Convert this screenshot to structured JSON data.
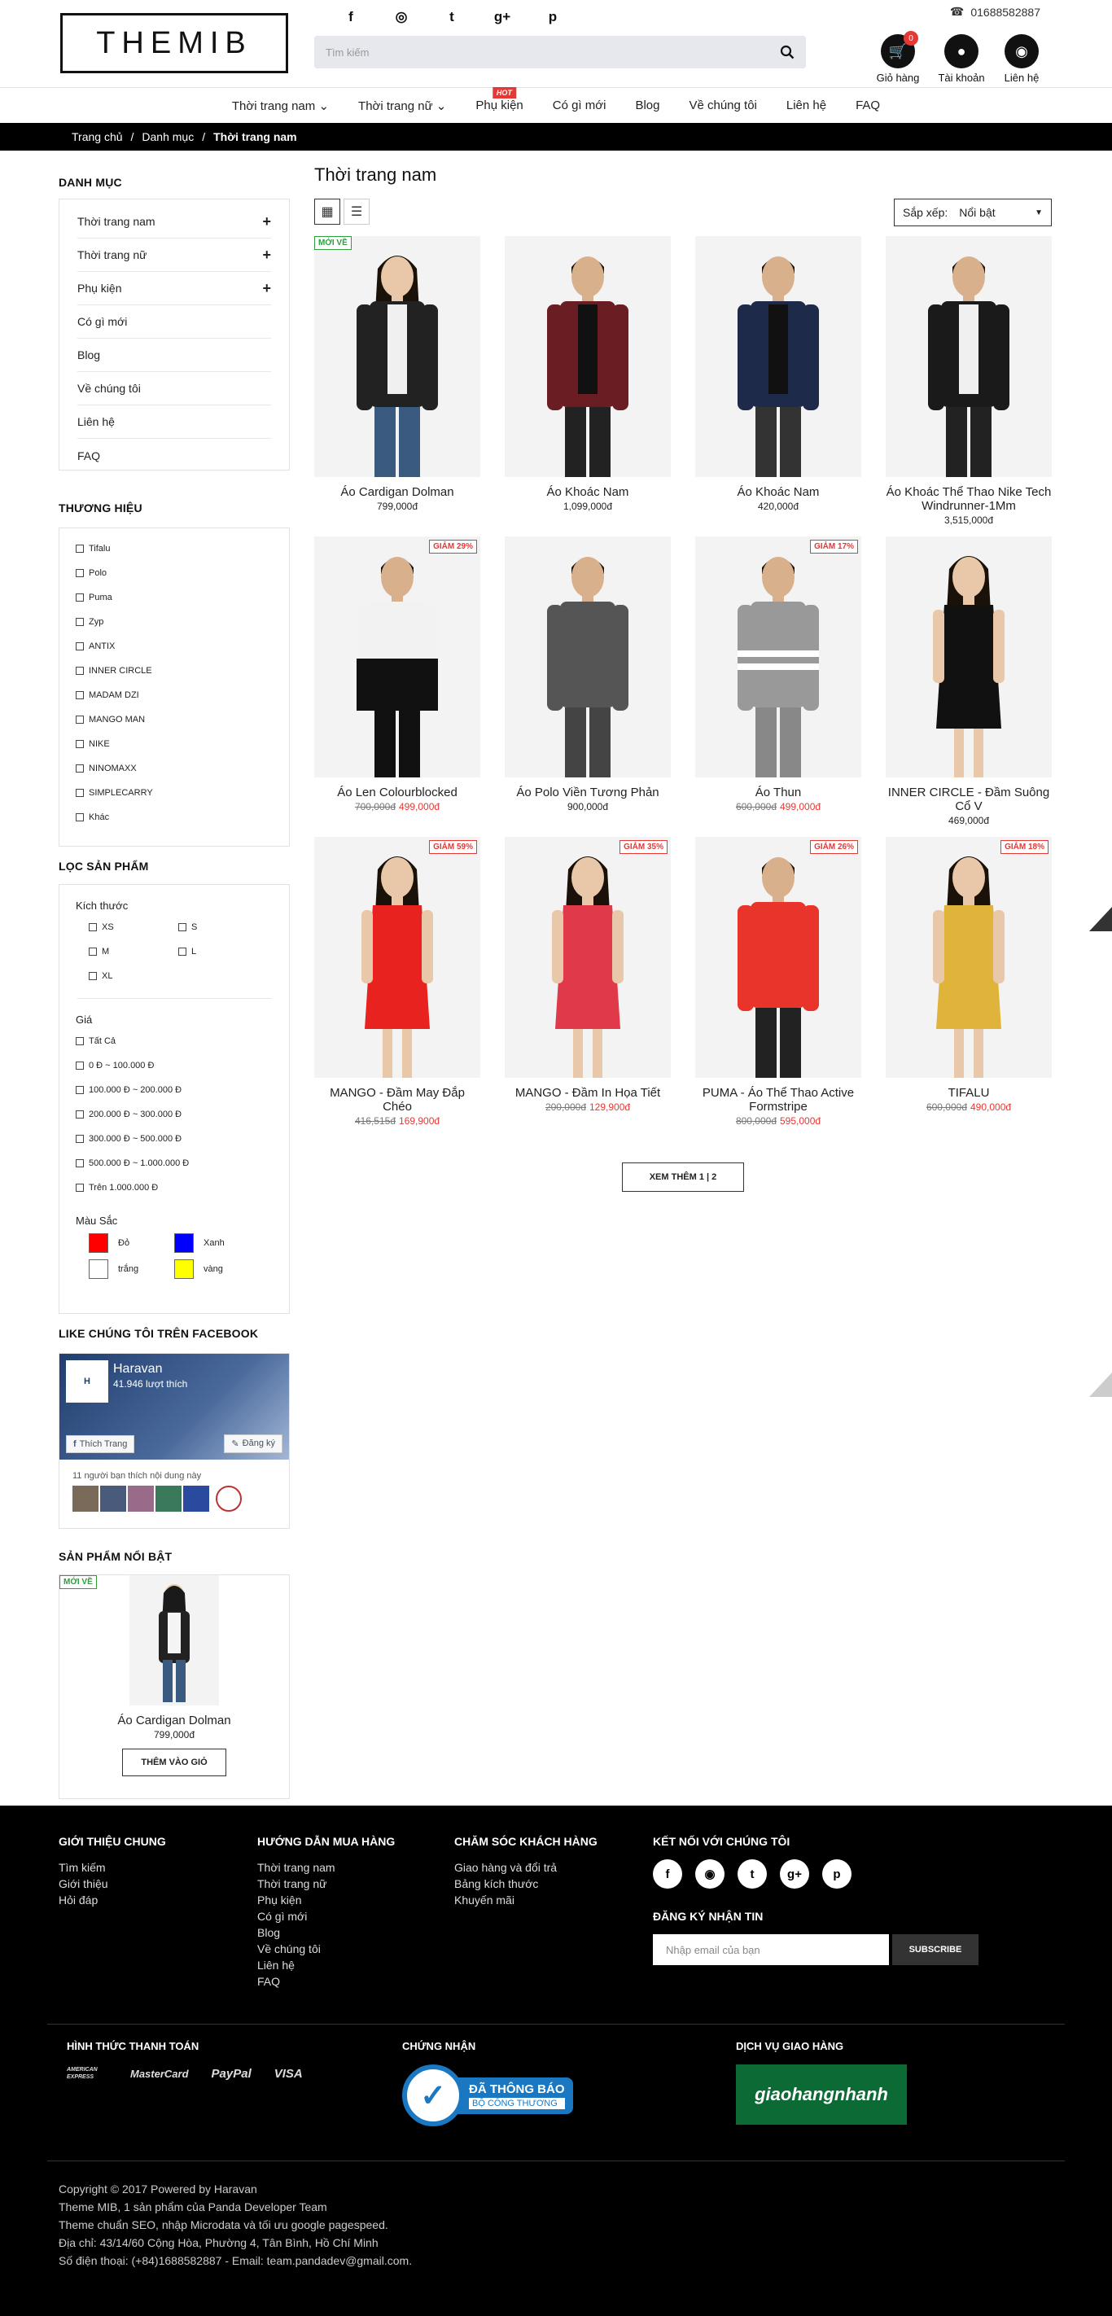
{
  "header": {
    "logo": "THEMIB",
    "phone": "01688582887",
    "search_placeholder": "Tìm kiếm",
    "social": [
      "f",
      "◎",
      "t",
      "g+",
      "p"
    ],
    "cart_count": "0",
    "cart_label": "Giỏ hàng",
    "account_label": "Tài khoản",
    "contact_label": "Liên hệ"
  },
  "nav": [
    {
      "label": "Thời trang nam",
      "dropdown": true
    },
    {
      "label": "Thời trang nữ",
      "dropdown": true
    },
    {
      "label": "Phụ kiện",
      "badge": "HOT"
    },
    {
      "label": "Có gì mới"
    },
    {
      "label": "Blog"
    },
    {
      "label": "Về chúng tôi"
    },
    {
      "label": "Liên hệ"
    },
    {
      "label": "FAQ"
    }
  ],
  "breadcrumb": {
    "home": "Trang chủ",
    "sep": "/",
    "category": "Danh mục",
    "current": "Thời trang nam"
  },
  "sidebar": {
    "category_title": "DANH MỤC",
    "categories": [
      "Thời trang nam",
      "Thời trang nữ",
      "Phụ kiện",
      "Có gì mới",
      "Blog",
      "Về chúng tôi",
      "Liên hệ",
      "FAQ"
    ],
    "brand_title": "THƯƠNG HIỆU",
    "brands": [
      "Tifalu",
      "Polo",
      "Puma",
      "Zyp",
      "ANTIX",
      "INNER CIRCLE",
      "MADAM DZI",
      "MANGO MAN",
      "NIKE",
      "NINOMAXX",
      "SIMPLECARRY",
      "Khác"
    ],
    "filter_title": "LỌC SẢN PHẨM",
    "size_label": "Kích thước",
    "sizes": [
      "XS",
      "S",
      "M",
      "L",
      "XL"
    ],
    "price_label": "Giá",
    "prices": [
      "Tất Cả",
      "0 Đ ~ 100.000 Đ",
      "100.000 Đ ~ 200.000 Đ",
      "200.000 Đ ~ 300.000 Đ",
      "300.000 Đ ~ 500.000 Đ",
      "500.000 Đ ~ 1.000.000 Đ",
      "Trên 1.000.000 Đ"
    ],
    "color_label": "Màu Sắc",
    "colors": [
      {
        "name": "Đỏ",
        "hex": "#ff0000"
      },
      {
        "name": "Xanh",
        "hex": "#0000ff"
      },
      {
        "name": "trắng",
        "hex": "#ffffff"
      },
      {
        "name": "vàng",
        "hex": "#ffff00"
      }
    ],
    "facebook_title": "LIKE CHÚNG TÔI TRÊN FACEBOOK",
    "fb_page": "Haravan",
    "fb_likes": "41.946 lượt thích",
    "fb_like_btn": "Thích Trang",
    "fb_subscribe_btn": "Đăng ký",
    "fb_friends": "11 người bạn thích nội dung này",
    "featured_title": "SẢN PHẨM NỔI BẬT",
    "featured": {
      "badge": "MỚI VỀ",
      "name": "Áo Cardigan Dolman",
      "price": "799,000đ",
      "button": "THÊM VÀO GIỎ"
    }
  },
  "main": {
    "title": "Thời trang nam",
    "sort_label": "Sắp xếp:",
    "sort_value": "Nổi bật",
    "load_more": "XEM THÊM 1 | 2",
    "products": [
      {
        "name": "Áo Cardigan Dolman",
        "price": "799,000đ",
        "old": "",
        "badge": "MỚI VỀ",
        "badge_type": "new",
        "top": "#222",
        "bottom": "#3a5a80",
        "skin": "#e8c8a8",
        "female": true
      },
      {
        "name": "Áo Khoác Nam",
        "price": "1,099,000đ",
        "old": "",
        "badge": "",
        "top": "#6a1e24",
        "bottom": "#222",
        "skin": "#d9b08c",
        "female": false
      },
      {
        "name": "Áo Khoác Nam",
        "price": "420,000đ",
        "old": "",
        "badge": "",
        "top": "#1e2a4a",
        "bottom": "#333",
        "skin": "#d9b08c",
        "female": false
      },
      {
        "name": "Áo Khoác Thể Thao Nike Tech Windrunner-1Mm",
        "price": "3,515,000đ",
        "old": "",
        "badge": "",
        "top": "#1a1a1a",
        "bottom": "#222",
        "skin": "#d9b08c",
        "female": false
      },
      {
        "name": "Áo Len Colourblocked",
        "price": "499,000đ",
        "old": "700,000đ",
        "badge": "GIẢM 29%",
        "badge_type": "sale",
        "top": "#f2f2f2",
        "bottom": "#111",
        "skin": "#d9b08c",
        "female": false
      },
      {
        "name": "Áo Polo Viền Tương Phản",
        "price": "900,000đ",
        "old": "",
        "badge": "",
        "top": "#555",
        "bottom": "#444",
        "skin": "#d9b08c",
        "female": false
      },
      {
        "name": "Áo Thun",
        "price": "499,000đ",
        "old": "600,000đ",
        "badge": "GIẢM 17%",
        "badge_type": "sale",
        "top": "#999",
        "bottom": "#888",
        "skin": "#d9b08c",
        "female": false
      },
      {
        "name": "INNER CIRCLE - Đầm Suông Cổ V",
        "price": "469,000đ",
        "old": "",
        "badge": "",
        "top": "#111",
        "bottom": "#111",
        "skin": "#e8c8a8",
        "female": true
      },
      {
        "name": "MANGO - Đầm May Đắp Chéo",
        "price": "169,900đ",
        "old": "416,515đ",
        "badge": "GIẢM 59%",
        "badge_type": "sale",
        "top": "#e8231f",
        "bottom": "#e8231f",
        "skin": "#e8c8a8",
        "female": true
      },
      {
        "name": "MANGO - Đầm In Họa Tiết",
        "price": "129,900đ",
        "old": "200,000đ",
        "badge": "GIẢM 35%",
        "badge_type": "sale",
        "top": "#e03a4a",
        "bottom": "#e03a4a",
        "skin": "#e8c8a8",
        "female": true
      },
      {
        "name": "PUMA - Áo Thể Thao Active Formstripe",
        "price": "595,000đ",
        "old": "800,000đ",
        "badge": "GIẢM 26%",
        "badge_type": "sale",
        "top": "#e8342a",
        "bottom": "#222",
        "skin": "#d9b08c",
        "female": false
      },
      {
        "name": "TIFALU",
        "price": "490,000đ",
        "old": "600,000đ",
        "badge": "GIẢM 18%",
        "badge_type": "sale",
        "top": "#e0b43a",
        "bottom": "#e0b43a",
        "skin": "#e8c8a8",
        "female": true
      }
    ]
  },
  "footer": {
    "col1_title": "GIỚI THIỆU CHUNG",
    "col1": [
      "Tìm kiếm",
      "Giới thiệu",
      "Hỏi đáp"
    ],
    "col2_title": "HƯỚNG DẪN MUA HÀNG",
    "col2": [
      "Thời trang nam",
      "Thời trang nữ",
      "Phụ kiện",
      "Có gì mới",
      "Blog",
      "Về chúng tôi",
      "Liên hệ",
      "FAQ"
    ],
    "col3_title": "CHĂM SÓC KHÁCH HÀNG",
    "col3": [
      "Giao hàng và đổi trả",
      "Bảng kích thước",
      "Khuyến mãi"
    ],
    "col4_title": "KẾT NỐI VỚI CHÚNG TÔI",
    "newsletter_title": "ĐĂNG KÝ NHẬN TIN",
    "newsletter_placeholder": "Nhập email của bạn",
    "subscribe": "SUBSCRIBE",
    "pay_title": "HÌNH THỨC THANH TOÁN",
    "pay": [
      "AMERICAN EXPRESS",
      "MasterCard",
      "PayPal",
      "VISA"
    ],
    "cert_title": "CHỨNG NHẬN",
    "cert_line1": "ĐÃ THÔNG BÁO",
    "cert_line2": "BỘ CÔNG THƯƠNG",
    "ship_title": "DỊCH VỤ GIAO HÀNG",
    "ship_logo": "giaohangnhanh",
    "copyright": [
      "Copyright © 2017 Powered by Haravan",
      "Theme MIB, 1 sản phẩm của Panda Developer Team",
      "Theme chuẩn SEO, nhập Microdata và tối ưu google pagespeed.",
      "Địa chỉ: 43/14/60 Cộng Hòa, Phường 4, Tân Bình, Hồ Chí Minh",
      "Số điện thoại: (+84)1688582887 - Email: team.pandadev@gmail.com."
    ]
  }
}
